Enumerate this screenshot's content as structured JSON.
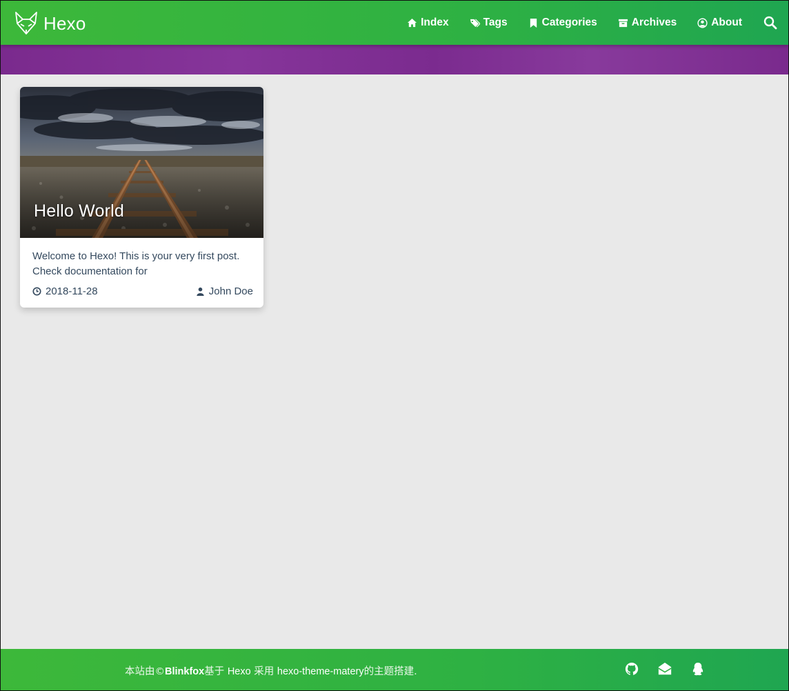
{
  "header": {
    "brand_name": "Hexo",
    "nav": [
      {
        "label": "Index",
        "icon": "home-icon"
      },
      {
        "label": "Tags",
        "icon": "tags-icon"
      },
      {
        "label": "Categories",
        "icon": "bookmark-icon"
      },
      {
        "label": "Archives",
        "icon": "archive-icon"
      },
      {
        "label": "About",
        "icon": "user-circle-icon"
      }
    ],
    "search_icon": "search-icon"
  },
  "colors": {
    "nav_green": "#2eb143",
    "banner_purple": "#7f2f93",
    "page_bg": "#e9e9e9",
    "text": "#34495e"
  },
  "post": {
    "title": "Hello World",
    "summary": "Welcome to Hexo! This is your very first post. Check documentation for",
    "date": "2018-11-28",
    "author": "John Doe",
    "date_icon": "clock-icon",
    "author_icon": "user-icon"
  },
  "footer": {
    "prefix": "本站由©",
    "author": "Blinkfox",
    "mid1": "基于 ",
    "framework": "Hexo",
    "mid2": " 采用 ",
    "theme": "hexo-theme-matery",
    "suffix": "的主题搭建.",
    "social_icons": [
      "github-icon",
      "email-icon",
      "qq-icon"
    ]
  }
}
